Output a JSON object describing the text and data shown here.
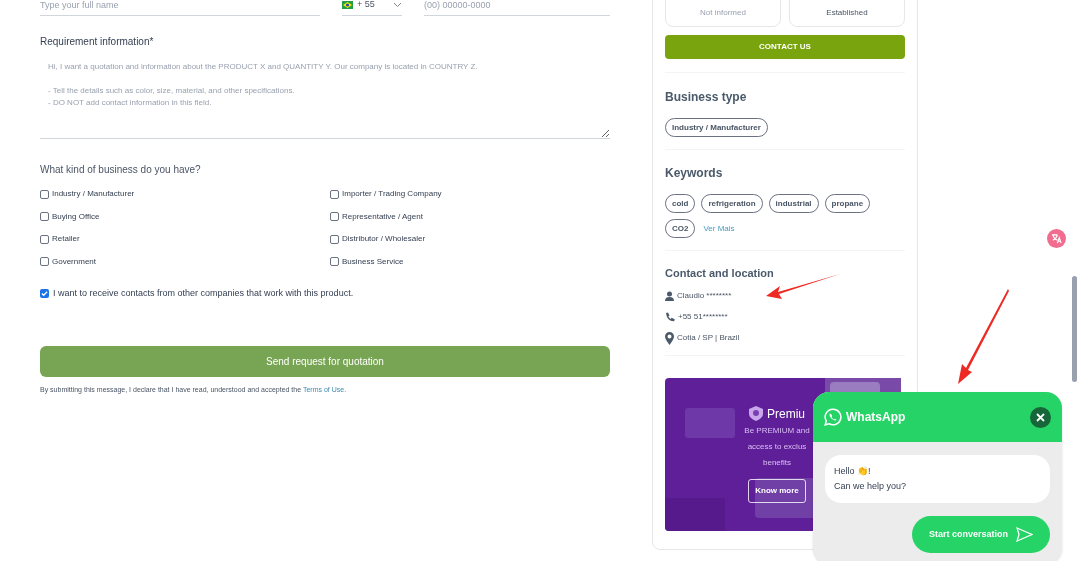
{
  "form": {
    "name_field": {
      "placeholder": "Type your full name"
    },
    "phone_field": {
      "country_code": "+ 55",
      "placeholder": "(00) 00000-0000"
    },
    "requirement": {
      "label": "Requirement information*",
      "placeholder": "Hi, I want a quotation and information about the PRODUCT X and QUANTITY Y. Our company is located in COUNTRY Z.\n\n- Tell the details such as color, size, material, and other specifications.\n- DO NOT add contact information in this field."
    },
    "business_question": "What kind of business do you have?",
    "business_options": [
      {
        "label": "Industry / Manufacturer",
        "checked": false
      },
      {
        "label": "Importer / Trading Company",
        "checked": false
      },
      {
        "label": "Buying Office",
        "checked": false
      },
      {
        "label": "Representative / Agent",
        "checked": false
      },
      {
        "label": "Retailer",
        "checked": false
      },
      {
        "label": "Distributor / Wholesaler",
        "checked": false
      },
      {
        "label": "Government",
        "checked": false
      },
      {
        "label": "Business Service",
        "checked": false
      }
    ],
    "receive_contacts": {
      "label": "I want to receive contacts from other companies that work with this product.",
      "checked": true
    },
    "submit_button": "Send request for quotation",
    "disclaimer": "By submitting this message, I declare that I have read, understood and accepted the ",
    "terms_link": "Terms of Use."
  },
  "sidebar": {
    "stats": [
      "Not informed",
      "Established"
    ],
    "contact_button": "CONTACT US",
    "business_type": {
      "title": "Business type",
      "tags": [
        "Industry / Manufacturer"
      ]
    },
    "keywords": {
      "title": "Keywords",
      "tags": [
        "cold",
        "refrigeration",
        "industrial",
        "propane",
        "CO2"
      ],
      "more_link": "Ver Mais"
    },
    "contact": {
      "title": "Contact and location",
      "items": [
        {
          "kind": "person",
          "text": "Claudio ********"
        },
        {
          "kind": "phone",
          "text": "+55 51********"
        },
        {
          "kind": "location",
          "text": "Cotia / SP | Brazil"
        }
      ]
    },
    "premium": {
      "title": "Premiu",
      "lines": [
        "Be PREMIUM and",
        "access to exclus",
        "benefits"
      ],
      "button": "Know more"
    }
  },
  "whatsapp": {
    "title": "WhatsApp",
    "greeting": [
      "Hello 👏!",
      "Can we help you?"
    ],
    "button": "Start conversation"
  }
}
